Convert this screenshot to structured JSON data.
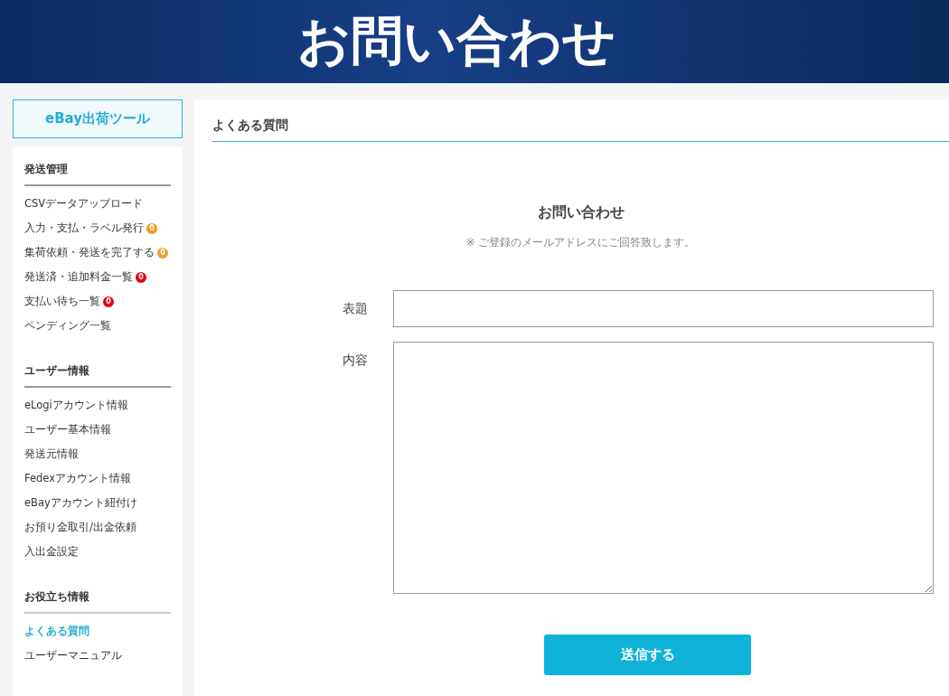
{
  "banner": {
    "title": "お問い合わせ"
  },
  "sidebar": {
    "brand": "eBay出荷ツール",
    "sections": [
      {
        "heading": "発送管理",
        "items": [
          {
            "label": "CSVデータアップロード",
            "selected": false
          },
          {
            "label": "入力・支払・ラベル発行",
            "selected": false,
            "badge": {
              "text": "0",
              "color": "#f39c26"
            }
          },
          {
            "label": "集荷依頼・発送を完了する",
            "selected": false,
            "badge": {
              "text": "0",
              "color": "#f39c26"
            }
          },
          {
            "label": "発送済・追加料金一覧",
            "selected": false,
            "badge": {
              "text": "0",
              "color": "#e60012"
            }
          },
          {
            "label": "支払い待ち一覧",
            "selected": false,
            "badge": {
              "text": "0",
              "color": "#e60012"
            }
          },
          {
            "label": "ペンディング一覧",
            "selected": false
          }
        ]
      },
      {
        "heading": "ユーザー情報",
        "items": [
          {
            "label": "eLogiアカウント情報",
            "selected": false
          },
          {
            "label": "ユーザー基本情報",
            "selected": false
          },
          {
            "label": "発送元情報",
            "selected": false
          },
          {
            "label": "Fedexアカウント情報",
            "selected": false
          },
          {
            "label": "eBayアカウント紐付け",
            "selected": false
          },
          {
            "label": "お預り金取引/出金依頼",
            "selected": false
          },
          {
            "label": "入出金設定",
            "selected": false
          }
        ]
      },
      {
        "heading": "お役立ち情報",
        "items": [
          {
            "label": "よくある質問",
            "selected": true
          },
          {
            "label": "ユーザーマニュアル",
            "selected": false
          }
        ]
      }
    ]
  },
  "page": {
    "heading": "よくある質問",
    "form_title": "お問い合わせ",
    "note": "※ ご登録のメールアドレスにご回答致します。",
    "fields": [
      {
        "label": "表題",
        "kind": "text"
      },
      {
        "label": "内容",
        "kind": "textarea"
      }
    ],
    "submit": "送信する"
  }
}
